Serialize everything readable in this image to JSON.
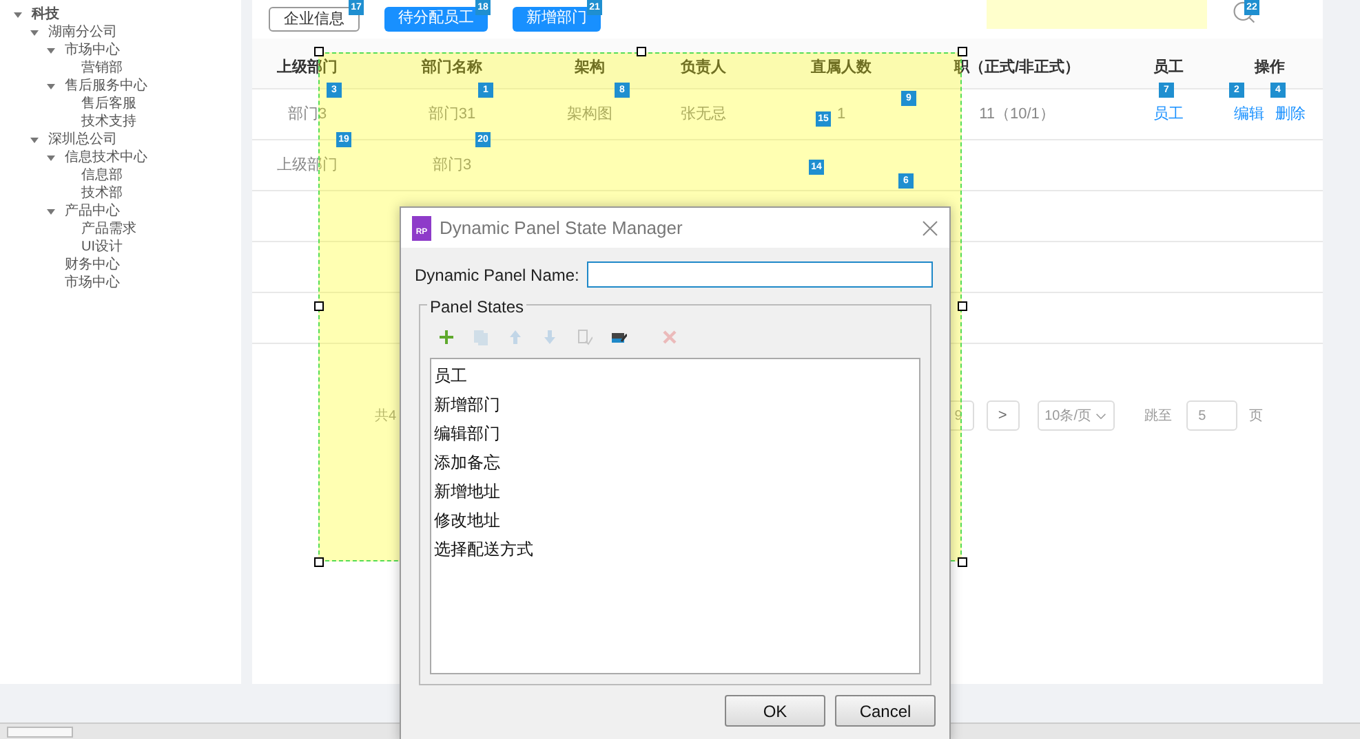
{
  "tree": [
    {
      "label": "科技",
      "expanded": true,
      "children": [
        {
          "label": "湖南分公司",
          "expanded": true,
          "children": [
            {
              "label": "市场中心",
              "expanded": true,
              "children": [
                {
                  "label": "营销部"
                }
              ]
            },
            {
              "label": "售后服务中心",
              "expanded": true,
              "children": [
                {
                  "label": "售后客服"
                },
                {
                  "label": "技术支持"
                }
              ]
            }
          ]
        },
        {
          "label": "深圳总公司",
          "expanded": true,
          "children": [
            {
              "label": "信息技术中心",
              "expanded": true,
              "children": [
                {
                  "label": "信息部"
                },
                {
                  "label": "技术部"
                }
              ]
            },
            {
              "label": "产品中心",
              "expanded": true,
              "children": [
                {
                  "label": "产品需求"
                },
                {
                  "label": "UI设计"
                }
              ]
            },
            {
              "label": "财务中心"
            },
            {
              "label": "市场中心"
            }
          ]
        }
      ]
    }
  ],
  "toolbar": [
    {
      "label": "企业信息",
      "kind": "outline"
    },
    {
      "label": "待分配员工",
      "kind": "primary"
    },
    {
      "label": "新增部门",
      "kind": "primary"
    }
  ],
  "table": {
    "columns": [
      "上级部门",
      "部门名称",
      "架构",
      "负责人",
      "直属人数",
      "职（正式/非正式）",
      "员工",
      "操作"
    ],
    "rows": [
      {
        "cells": [
          {
            "kind": "text",
            "text": "部门3"
          },
          {
            "kind": "text",
            "text": "部门31"
          },
          {
            "kind": "text",
            "text": "架构图"
          },
          {
            "kind": "text",
            "text": "张无忌"
          },
          {
            "kind": "text",
            "text": "1"
          },
          {
            "kind": "text",
            "text": "11（10/1）"
          },
          {
            "kind": "link",
            "text": "员工"
          },
          {
            "kind": "actions",
            "links": [
              "编辑",
              "删除"
            ]
          }
        ]
      },
      {
        "cells": [
          {
            "kind": "text",
            "text": "上级部门"
          },
          {
            "kind": "text",
            "text": "部门3"
          }
        ]
      }
    ]
  },
  "pagination": {
    "total": "共4",
    "page": "9",
    "next": ">",
    "page_size": "10条/页",
    "jump_label": "跳至",
    "jump_value": "5",
    "jump_suffix": "页"
  },
  "markers": [
    "17",
    "18",
    "21",
    "3",
    "1",
    "8",
    "19",
    "20",
    "15",
    "9",
    "14",
    "6",
    "7",
    "2",
    "4",
    "22"
  ],
  "dialog": {
    "title": "Dynamic Panel State Manager",
    "logo": "RP",
    "name_label": "Dynamic Panel Name:",
    "group_label": "Panel States",
    "tools": [
      {
        "kind": "add",
        "disabled": false
      },
      {
        "kind": "copy",
        "disabled": true
      },
      {
        "kind": "up",
        "disabled": true
      },
      {
        "kind": "down",
        "disabled": true
      },
      {
        "kind": "duplicate",
        "disabled": true
      },
      {
        "kind": "edit",
        "disabled": false
      },
      {
        "kind": "delete",
        "disabled": true
      }
    ],
    "states": [
      "员工",
      "新增部门",
      "编辑部门",
      "添加备忘",
      "新增地址",
      "修改地址",
      "选择配送方式"
    ],
    "buttons": [
      "OK",
      "Cancel"
    ]
  }
}
